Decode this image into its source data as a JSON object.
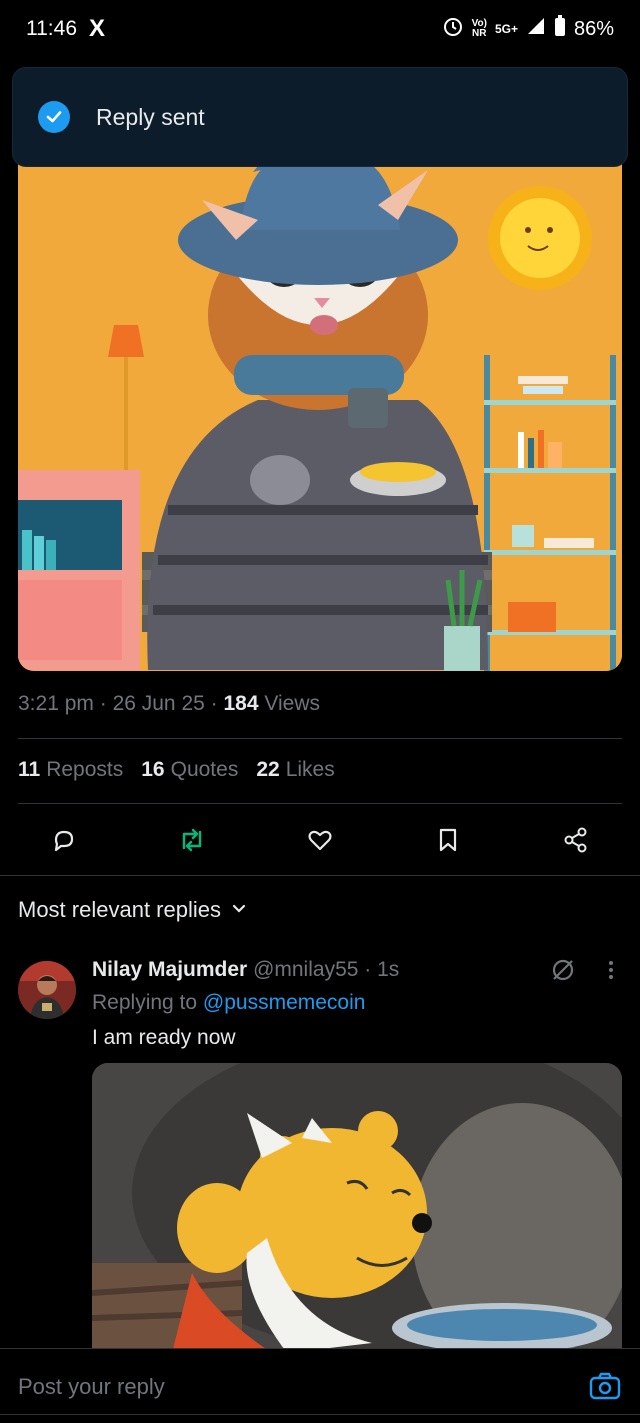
{
  "status_bar": {
    "time": "11:46",
    "x_logo": "X",
    "signal_label_top": "Vo)",
    "signal_label_bottom": "NR",
    "network": "5G+",
    "battery": "86%"
  },
  "toast": {
    "text": "Reply sent"
  },
  "post": {
    "time": "3:21 pm",
    "date": "26 Jun 25",
    "views_count": "184",
    "views_label": "Views",
    "reposts_count": "11",
    "reposts_label": "Reposts",
    "quotes_count": "16",
    "quotes_label": "Quotes",
    "likes_count": "22",
    "likes_label": "Likes"
  },
  "sort": {
    "label": "Most relevant replies"
  },
  "reply": {
    "name": "Nilay Majumder",
    "handle": "@mnilay55",
    "time": "1s",
    "replying_prefix": "Replying to",
    "replying_to": "@pussmemecoin",
    "text": "I am ready now"
  },
  "composer": {
    "placeholder": "Post your reply"
  },
  "colors": {
    "accent": "#1d9bf0",
    "repost_green": "#00ba7c",
    "muted": "#71767b"
  }
}
